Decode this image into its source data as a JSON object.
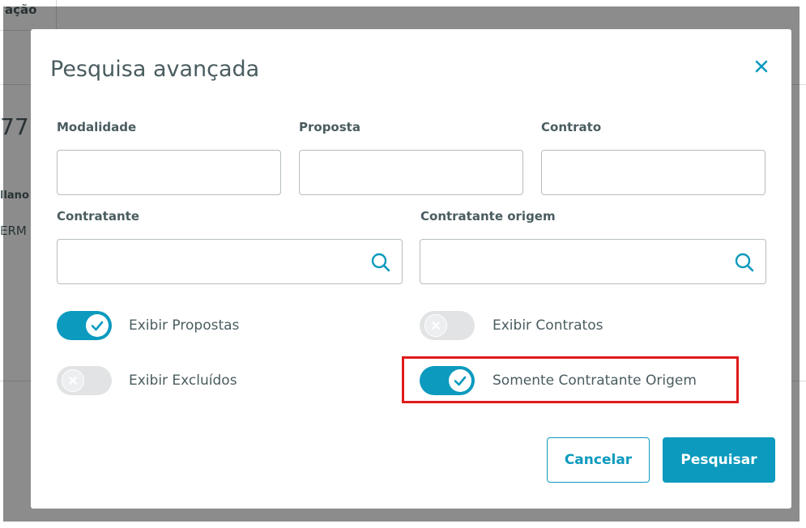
{
  "background": {
    "tab_fragment": "ação",
    "title_fragment": "77)",
    "label_fragment": "llano",
    "value_fragment": "ERM"
  },
  "modal": {
    "title": "Pesquisa avançada",
    "close_icon": "close-icon",
    "fields": {
      "modalidade": {
        "label": "Modalidade",
        "value": "",
        "placeholder": ""
      },
      "proposta": {
        "label": "Proposta",
        "value": "",
        "placeholder": ""
      },
      "contrato": {
        "label": "Contrato",
        "value": "",
        "placeholder": ""
      },
      "contratante": {
        "label": "Contratante",
        "value": "",
        "placeholder": "",
        "icon": "search-icon"
      },
      "contratante_origem": {
        "label": "Contratante origem",
        "value": "",
        "placeholder": "",
        "icon": "search-icon"
      }
    },
    "switches": {
      "exibir_propostas": {
        "label": "Exibir Propostas",
        "checked": true
      },
      "exibir_contratos": {
        "label": "Exibir Contratos",
        "checked": false
      },
      "exibir_excluidos": {
        "label": "Exibir Excluídos",
        "checked": false
      },
      "somente_contratante_origem": {
        "label": "Somente Contratante Origem",
        "checked": true
      }
    },
    "buttons": {
      "cancel_label": "Cancelar",
      "search_label": "Pesquisar"
    }
  },
  "colors": {
    "accent": "#0c9abe",
    "text": "#4a5c60",
    "highlight": "#e01b1b",
    "switch_off": "#e1e3e4"
  }
}
